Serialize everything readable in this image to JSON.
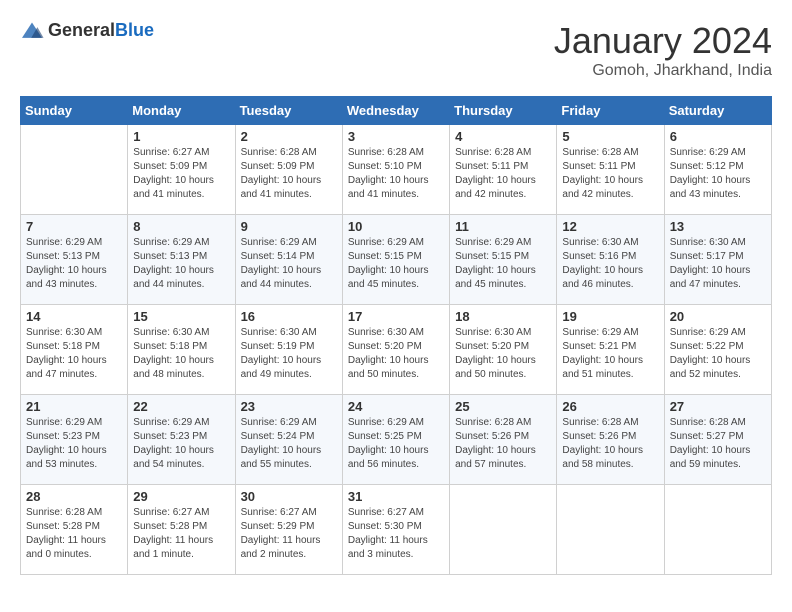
{
  "header": {
    "logo_general": "General",
    "logo_blue": "Blue",
    "month": "January 2024",
    "location": "Gomoh, Jharkhand, India"
  },
  "weekdays": [
    "Sunday",
    "Monday",
    "Tuesday",
    "Wednesday",
    "Thursday",
    "Friday",
    "Saturday"
  ],
  "weeks": [
    [
      {
        "day": "",
        "sunrise": "",
        "sunset": "",
        "daylight": ""
      },
      {
        "day": "1",
        "sunrise": "Sunrise: 6:27 AM",
        "sunset": "Sunset: 5:09 PM",
        "daylight": "Daylight: 10 hours and 41 minutes."
      },
      {
        "day": "2",
        "sunrise": "Sunrise: 6:28 AM",
        "sunset": "Sunset: 5:09 PM",
        "daylight": "Daylight: 10 hours and 41 minutes."
      },
      {
        "day": "3",
        "sunrise": "Sunrise: 6:28 AM",
        "sunset": "Sunset: 5:10 PM",
        "daylight": "Daylight: 10 hours and 41 minutes."
      },
      {
        "day": "4",
        "sunrise": "Sunrise: 6:28 AM",
        "sunset": "Sunset: 5:11 PM",
        "daylight": "Daylight: 10 hours and 42 minutes."
      },
      {
        "day": "5",
        "sunrise": "Sunrise: 6:28 AM",
        "sunset": "Sunset: 5:11 PM",
        "daylight": "Daylight: 10 hours and 42 minutes."
      },
      {
        "day": "6",
        "sunrise": "Sunrise: 6:29 AM",
        "sunset": "Sunset: 5:12 PM",
        "daylight": "Daylight: 10 hours and 43 minutes."
      }
    ],
    [
      {
        "day": "7",
        "sunrise": "Sunrise: 6:29 AM",
        "sunset": "Sunset: 5:13 PM",
        "daylight": "Daylight: 10 hours and 43 minutes."
      },
      {
        "day": "8",
        "sunrise": "Sunrise: 6:29 AM",
        "sunset": "Sunset: 5:13 PM",
        "daylight": "Daylight: 10 hours and 44 minutes."
      },
      {
        "day": "9",
        "sunrise": "Sunrise: 6:29 AM",
        "sunset": "Sunset: 5:14 PM",
        "daylight": "Daylight: 10 hours and 44 minutes."
      },
      {
        "day": "10",
        "sunrise": "Sunrise: 6:29 AM",
        "sunset": "Sunset: 5:15 PM",
        "daylight": "Daylight: 10 hours and 45 minutes."
      },
      {
        "day": "11",
        "sunrise": "Sunrise: 6:29 AM",
        "sunset": "Sunset: 5:15 PM",
        "daylight": "Daylight: 10 hours and 45 minutes."
      },
      {
        "day": "12",
        "sunrise": "Sunrise: 6:30 AM",
        "sunset": "Sunset: 5:16 PM",
        "daylight": "Daylight: 10 hours and 46 minutes."
      },
      {
        "day": "13",
        "sunrise": "Sunrise: 6:30 AM",
        "sunset": "Sunset: 5:17 PM",
        "daylight": "Daylight: 10 hours and 47 minutes."
      }
    ],
    [
      {
        "day": "14",
        "sunrise": "Sunrise: 6:30 AM",
        "sunset": "Sunset: 5:18 PM",
        "daylight": "Daylight: 10 hours and 47 minutes."
      },
      {
        "day": "15",
        "sunrise": "Sunrise: 6:30 AM",
        "sunset": "Sunset: 5:18 PM",
        "daylight": "Daylight: 10 hours and 48 minutes."
      },
      {
        "day": "16",
        "sunrise": "Sunrise: 6:30 AM",
        "sunset": "Sunset: 5:19 PM",
        "daylight": "Daylight: 10 hours and 49 minutes."
      },
      {
        "day": "17",
        "sunrise": "Sunrise: 6:30 AM",
        "sunset": "Sunset: 5:20 PM",
        "daylight": "Daylight: 10 hours and 50 minutes."
      },
      {
        "day": "18",
        "sunrise": "Sunrise: 6:30 AM",
        "sunset": "Sunset: 5:20 PM",
        "daylight": "Daylight: 10 hours and 50 minutes."
      },
      {
        "day": "19",
        "sunrise": "Sunrise: 6:29 AM",
        "sunset": "Sunset: 5:21 PM",
        "daylight": "Daylight: 10 hours and 51 minutes."
      },
      {
        "day": "20",
        "sunrise": "Sunrise: 6:29 AM",
        "sunset": "Sunset: 5:22 PM",
        "daylight": "Daylight: 10 hours and 52 minutes."
      }
    ],
    [
      {
        "day": "21",
        "sunrise": "Sunrise: 6:29 AM",
        "sunset": "Sunset: 5:23 PM",
        "daylight": "Daylight: 10 hours and 53 minutes."
      },
      {
        "day": "22",
        "sunrise": "Sunrise: 6:29 AM",
        "sunset": "Sunset: 5:23 PM",
        "daylight": "Daylight: 10 hours and 54 minutes."
      },
      {
        "day": "23",
        "sunrise": "Sunrise: 6:29 AM",
        "sunset": "Sunset: 5:24 PM",
        "daylight": "Daylight: 10 hours and 55 minutes."
      },
      {
        "day": "24",
        "sunrise": "Sunrise: 6:29 AM",
        "sunset": "Sunset: 5:25 PM",
        "daylight": "Daylight: 10 hours and 56 minutes."
      },
      {
        "day": "25",
        "sunrise": "Sunrise: 6:28 AM",
        "sunset": "Sunset: 5:26 PM",
        "daylight": "Daylight: 10 hours and 57 minutes."
      },
      {
        "day": "26",
        "sunrise": "Sunrise: 6:28 AM",
        "sunset": "Sunset: 5:26 PM",
        "daylight": "Daylight: 10 hours and 58 minutes."
      },
      {
        "day": "27",
        "sunrise": "Sunrise: 6:28 AM",
        "sunset": "Sunset: 5:27 PM",
        "daylight": "Daylight: 10 hours and 59 minutes."
      }
    ],
    [
      {
        "day": "28",
        "sunrise": "Sunrise: 6:28 AM",
        "sunset": "Sunset: 5:28 PM",
        "daylight": "Daylight: 11 hours and 0 minutes."
      },
      {
        "day": "29",
        "sunrise": "Sunrise: 6:27 AM",
        "sunset": "Sunset: 5:28 PM",
        "daylight": "Daylight: 11 hours and 1 minute."
      },
      {
        "day": "30",
        "sunrise": "Sunrise: 6:27 AM",
        "sunset": "Sunset: 5:29 PM",
        "daylight": "Daylight: 11 hours and 2 minutes."
      },
      {
        "day": "31",
        "sunrise": "Sunrise: 6:27 AM",
        "sunset": "Sunset: 5:30 PM",
        "daylight": "Daylight: 11 hours and 3 minutes."
      },
      {
        "day": "",
        "sunrise": "",
        "sunset": "",
        "daylight": ""
      },
      {
        "day": "",
        "sunrise": "",
        "sunset": "",
        "daylight": ""
      },
      {
        "day": "",
        "sunrise": "",
        "sunset": "",
        "daylight": ""
      }
    ]
  ]
}
